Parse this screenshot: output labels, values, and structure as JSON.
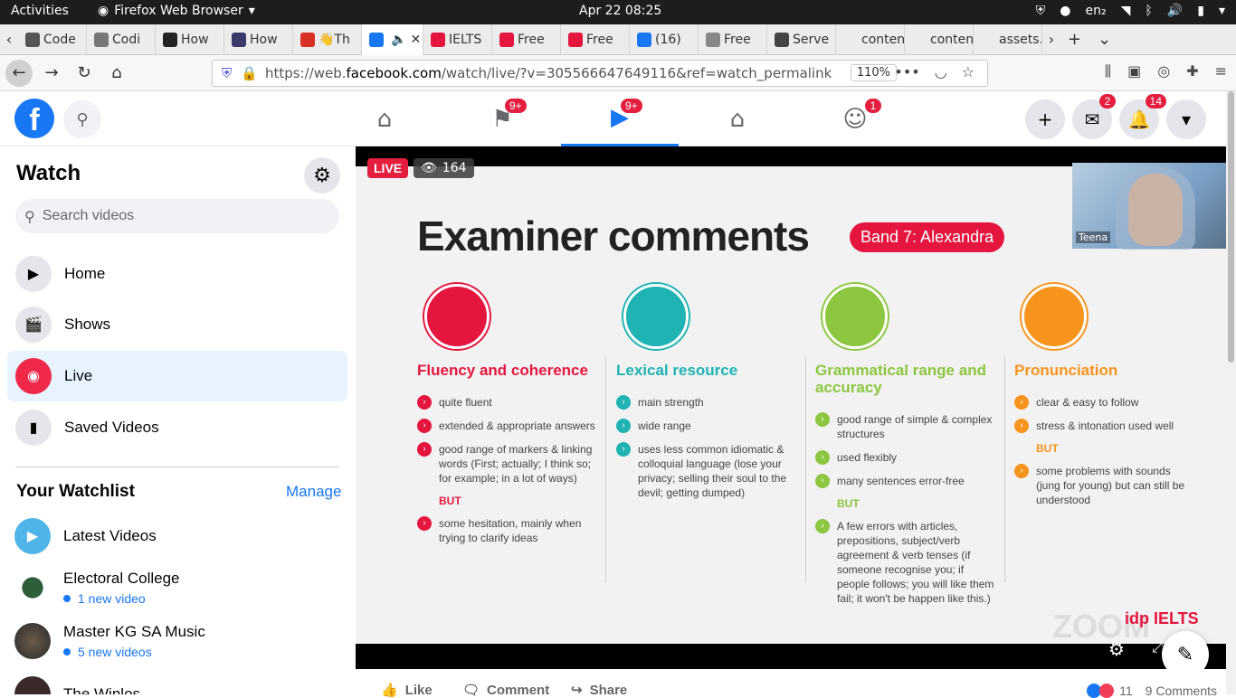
{
  "system": {
    "activities": "Activities",
    "app_name": "Firefox Web Browser",
    "clock": "Apr 22  08:25",
    "lang": "en₂"
  },
  "tabs": [
    {
      "label": "Code",
      "color": "#555"
    },
    {
      "label": "Codi",
      "color": "#777"
    },
    {
      "label": "How",
      "color": "#222"
    },
    {
      "label": "How",
      "color": "#3a3a6a"
    },
    {
      "label": "👋Th",
      "color": "#d93025"
    },
    {
      "label": "",
      "color": "#1877f2"
    },
    {
      "label": "IELTS",
      "color": "#e4163f"
    },
    {
      "label": "Free",
      "color": "#e4163f"
    },
    {
      "label": "Free",
      "color": "#e4163f"
    },
    {
      "label": "(16)",
      "color": "#1877f2"
    },
    {
      "label": "Free",
      "color": "#888"
    },
    {
      "label": "Serve",
      "color": "#444"
    },
    {
      "label": "content",
      "color": "#ececec"
    },
    {
      "label": "content",
      "color": "#ececec"
    },
    {
      "label": "assets.",
      "color": "#ececec"
    }
  ],
  "url": {
    "prefix": "https://web.",
    "domain": "facebook.com",
    "path": "/watch/live/?v=305566647649116&ref=watch_permalink",
    "zoom": "110%"
  },
  "fb": {
    "logo": "f",
    "badges": {
      "pages": "9+",
      "watch": "9+",
      "groups": "1",
      "messenger": "2",
      "notifications": "14"
    }
  },
  "sidebar": {
    "title": "Watch",
    "search_placeholder": "Search videos",
    "items": [
      {
        "label": "Home"
      },
      {
        "label": "Shows"
      },
      {
        "label": "Live"
      },
      {
        "label": "Saved Videos"
      }
    ],
    "watchlist_title": "Your Watchlist",
    "manage": "Manage",
    "watchlist": [
      {
        "name": "Latest Videos",
        "sub": ""
      },
      {
        "name": "Electoral College",
        "sub": "1 new video"
      },
      {
        "name": "Master KG SA Music",
        "sub": "5 new videos"
      },
      {
        "name": "The Winlos",
        "sub": ""
      }
    ]
  },
  "video": {
    "live": "LIVE",
    "viewers": "164",
    "presenter": "Teena",
    "slide_title": "Examiner comments",
    "band": "Band 7: Alexandra",
    "columns": [
      {
        "heading": "Fluency and coherence",
        "color": "#e4163f",
        "bullets": [
          "quite fluent",
          "extended & appropriate answers",
          "good range of markers & linking words (First; actually; I think so; for example; in a lot of ways)"
        ],
        "but": "BUT",
        "after": [
          "some hesitation, mainly when trying to clarify ideas"
        ]
      },
      {
        "heading": "Lexical resource",
        "color": "#1fb3b3",
        "bullets": [
          "main strength",
          "wide range",
          "uses less common idiomatic & colloquial language (lose your privacy; selling their soul to the devil; getting dumped)"
        ],
        "but": "",
        "after": []
      },
      {
        "heading": "Grammatical range and accuracy",
        "color": "#8dc63f",
        "bullets": [
          "good range of simple & complex structures",
          "used flexibly",
          "many sentences error-free"
        ],
        "but": "BUT",
        "after": [
          "A few errors with articles, prepositions, subject/verb agreement & verb tenses (if someone recognise you; if people follows; you will like them fail; it won't be happen like this.)"
        ]
      },
      {
        "heading": "Pronunciation",
        "color": "#f7941d",
        "bullets": [
          "clear & easy to follow",
          "stress & intonation used well"
        ],
        "but": "BUT",
        "after": [
          "some problems with sounds (jung for young) but can still be understood"
        ]
      }
    ],
    "watermark": "ZOOM",
    "logo_text": "idp IELTS"
  },
  "actions": {
    "like": "Like",
    "comment": "Comment",
    "share": "Share",
    "reactions": "11",
    "comments": "9 Comments"
  }
}
